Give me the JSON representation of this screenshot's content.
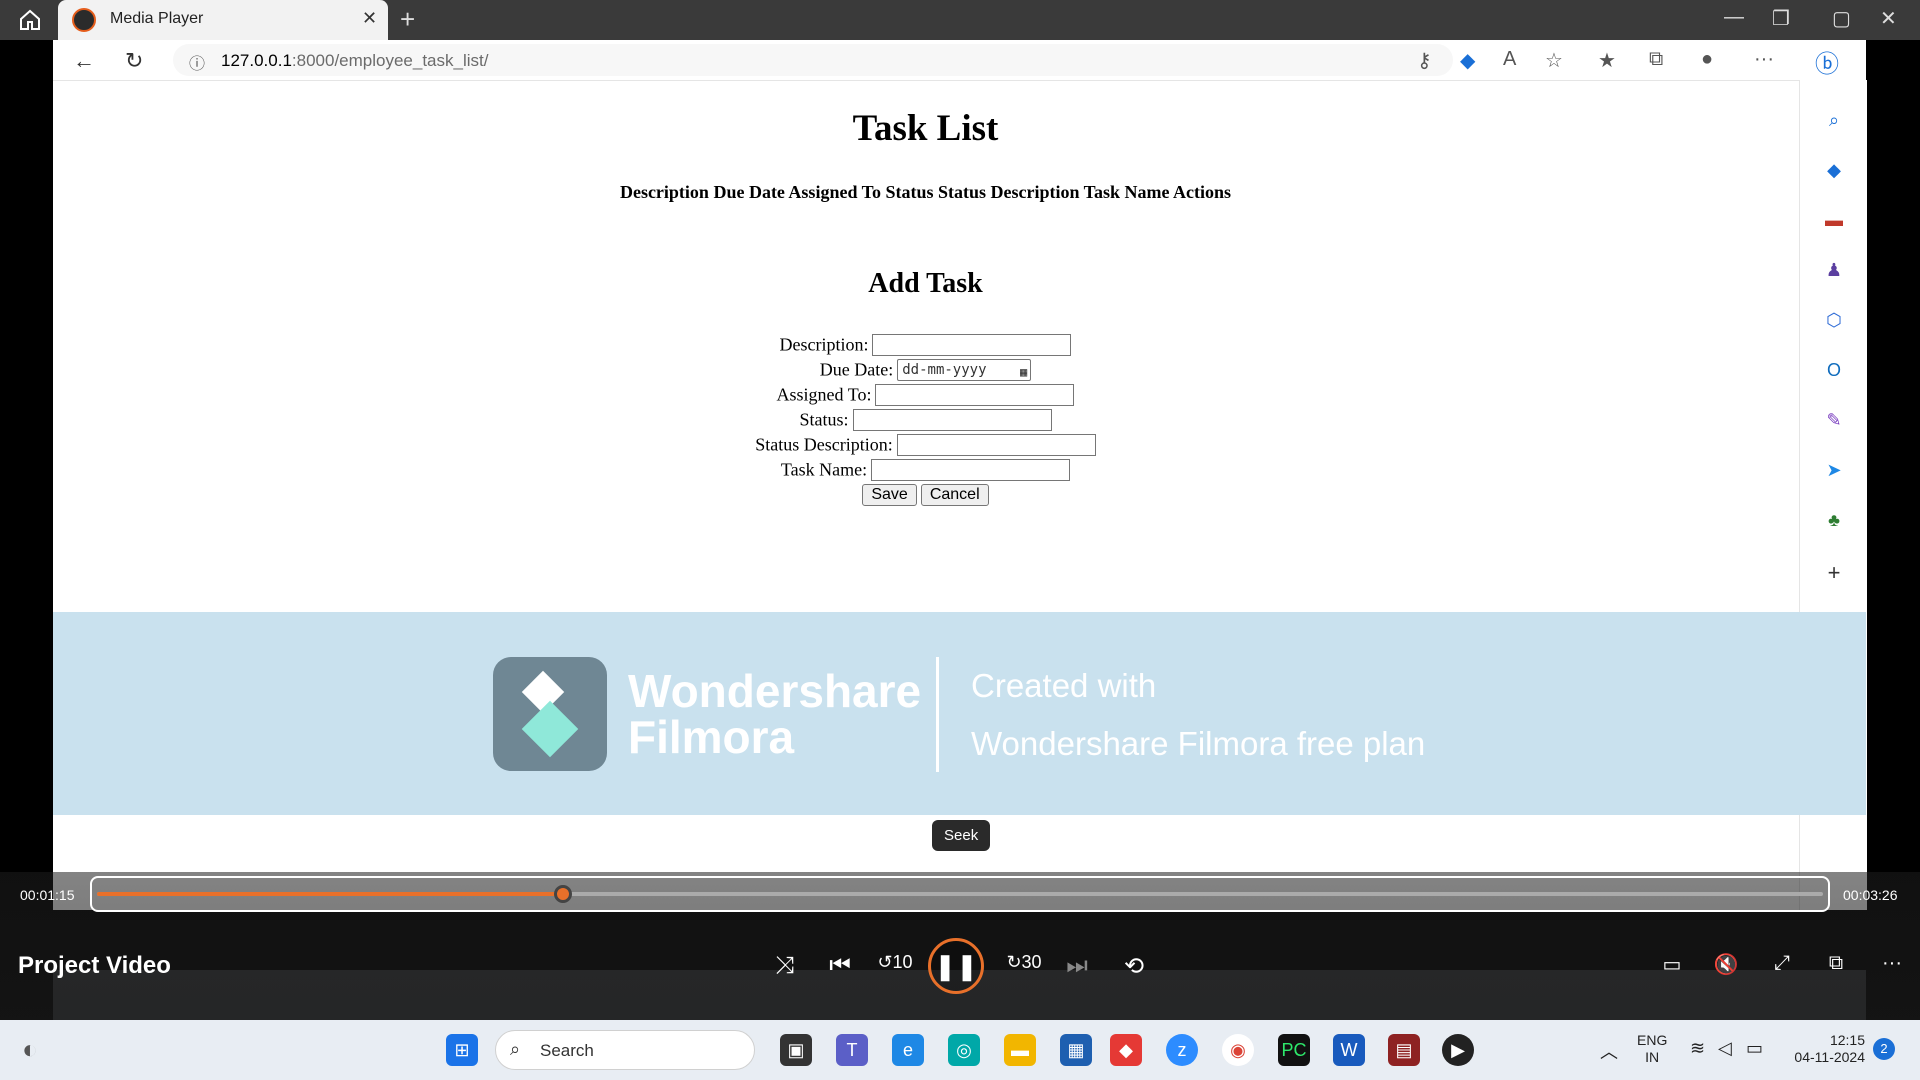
{
  "player": {
    "tab_title": "Media Player",
    "video_title": "Project Video",
    "current_time": "00:01:15",
    "total_time": "00:03:26",
    "progress_fraction": 0.27,
    "seek_tooltip": "Seek"
  },
  "browser": {
    "url_host": "127.0.0.1",
    "url_path": ":8000/employee_task_list/"
  },
  "page": {
    "title": "Task List",
    "table_header": "Description Due Date Assigned To Status Status Description Task Name Actions",
    "form_title": "Add Task",
    "fields": {
      "description": "Description:",
      "due_date": "Due Date:",
      "assigned_to": "Assigned To:",
      "status": "Status:",
      "status_description": "Status Description:",
      "task_name": "Task Name:"
    },
    "date_placeholder": "dd-mm-yyyy",
    "save_label": "Save",
    "cancel_label": "Cancel"
  },
  "watermark": {
    "brand_line1": "Wondershare",
    "brand_line2": "Filmora",
    "text_line1": "Created with",
    "text_line2": "Wondershare Filmora free plan"
  },
  "taskbar": {
    "search_placeholder": "Search",
    "lang_line1": "ENG",
    "lang_line2": "IN",
    "time": "12:15",
    "date": "04-11-2024",
    "notification_count": "2"
  },
  "colors": {
    "accent": "#e8702a",
    "watermark_bg": "#c9e1ee",
    "titlebar": "#3a3a3a"
  }
}
